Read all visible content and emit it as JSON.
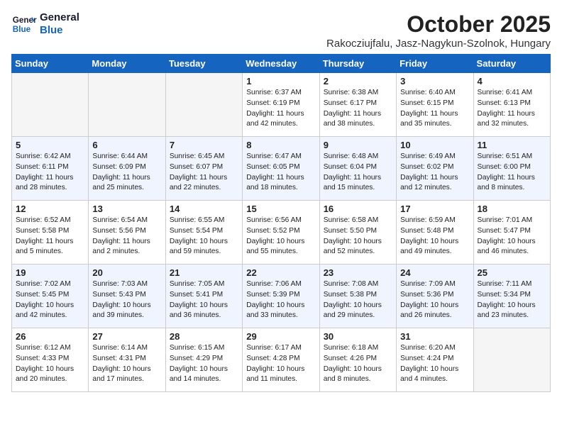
{
  "header": {
    "logo_line1": "General",
    "logo_line2": "Blue",
    "month_title": "October 2025",
    "location": "Rakocziujfalu, Jasz-Nagykun-Szolnok, Hungary"
  },
  "days_of_week": [
    "Sunday",
    "Monday",
    "Tuesday",
    "Wednesday",
    "Thursday",
    "Friday",
    "Saturday"
  ],
  "weeks": [
    [
      {
        "day": "",
        "info": "",
        "empty": true
      },
      {
        "day": "",
        "info": "",
        "empty": true
      },
      {
        "day": "",
        "info": "",
        "empty": true
      },
      {
        "day": "1",
        "info": "Sunrise: 6:37 AM\nSunset: 6:19 PM\nDaylight: 11 hours\nand 42 minutes."
      },
      {
        "day": "2",
        "info": "Sunrise: 6:38 AM\nSunset: 6:17 PM\nDaylight: 11 hours\nand 38 minutes."
      },
      {
        "day": "3",
        "info": "Sunrise: 6:40 AM\nSunset: 6:15 PM\nDaylight: 11 hours\nand 35 minutes."
      },
      {
        "day": "4",
        "info": "Sunrise: 6:41 AM\nSunset: 6:13 PM\nDaylight: 11 hours\nand 32 minutes."
      }
    ],
    [
      {
        "day": "5",
        "info": "Sunrise: 6:42 AM\nSunset: 6:11 PM\nDaylight: 11 hours\nand 28 minutes."
      },
      {
        "day": "6",
        "info": "Sunrise: 6:44 AM\nSunset: 6:09 PM\nDaylight: 11 hours\nand 25 minutes."
      },
      {
        "day": "7",
        "info": "Sunrise: 6:45 AM\nSunset: 6:07 PM\nDaylight: 11 hours\nand 22 minutes."
      },
      {
        "day": "8",
        "info": "Sunrise: 6:47 AM\nSunset: 6:05 PM\nDaylight: 11 hours\nand 18 minutes."
      },
      {
        "day": "9",
        "info": "Sunrise: 6:48 AM\nSunset: 6:04 PM\nDaylight: 11 hours\nand 15 minutes."
      },
      {
        "day": "10",
        "info": "Sunrise: 6:49 AM\nSunset: 6:02 PM\nDaylight: 11 hours\nand 12 minutes."
      },
      {
        "day": "11",
        "info": "Sunrise: 6:51 AM\nSunset: 6:00 PM\nDaylight: 11 hours\nand 8 minutes."
      }
    ],
    [
      {
        "day": "12",
        "info": "Sunrise: 6:52 AM\nSunset: 5:58 PM\nDaylight: 11 hours\nand 5 minutes."
      },
      {
        "day": "13",
        "info": "Sunrise: 6:54 AM\nSunset: 5:56 PM\nDaylight: 11 hours\nand 2 minutes."
      },
      {
        "day": "14",
        "info": "Sunrise: 6:55 AM\nSunset: 5:54 PM\nDaylight: 10 hours\nand 59 minutes."
      },
      {
        "day": "15",
        "info": "Sunrise: 6:56 AM\nSunset: 5:52 PM\nDaylight: 10 hours\nand 55 minutes."
      },
      {
        "day": "16",
        "info": "Sunrise: 6:58 AM\nSunset: 5:50 PM\nDaylight: 10 hours\nand 52 minutes."
      },
      {
        "day": "17",
        "info": "Sunrise: 6:59 AM\nSunset: 5:48 PM\nDaylight: 10 hours\nand 49 minutes."
      },
      {
        "day": "18",
        "info": "Sunrise: 7:01 AM\nSunset: 5:47 PM\nDaylight: 10 hours\nand 46 minutes."
      }
    ],
    [
      {
        "day": "19",
        "info": "Sunrise: 7:02 AM\nSunset: 5:45 PM\nDaylight: 10 hours\nand 42 minutes."
      },
      {
        "day": "20",
        "info": "Sunrise: 7:03 AM\nSunset: 5:43 PM\nDaylight: 10 hours\nand 39 minutes."
      },
      {
        "day": "21",
        "info": "Sunrise: 7:05 AM\nSunset: 5:41 PM\nDaylight: 10 hours\nand 36 minutes."
      },
      {
        "day": "22",
        "info": "Sunrise: 7:06 AM\nSunset: 5:39 PM\nDaylight: 10 hours\nand 33 minutes."
      },
      {
        "day": "23",
        "info": "Sunrise: 7:08 AM\nSunset: 5:38 PM\nDaylight: 10 hours\nand 29 minutes."
      },
      {
        "day": "24",
        "info": "Sunrise: 7:09 AM\nSunset: 5:36 PM\nDaylight: 10 hours\nand 26 minutes."
      },
      {
        "day": "25",
        "info": "Sunrise: 7:11 AM\nSunset: 5:34 PM\nDaylight: 10 hours\nand 23 minutes."
      }
    ],
    [
      {
        "day": "26",
        "info": "Sunrise: 6:12 AM\nSunset: 4:33 PM\nDaylight: 10 hours\nand 20 minutes."
      },
      {
        "day": "27",
        "info": "Sunrise: 6:14 AM\nSunset: 4:31 PM\nDaylight: 10 hours\nand 17 minutes."
      },
      {
        "day": "28",
        "info": "Sunrise: 6:15 AM\nSunset: 4:29 PM\nDaylight: 10 hours\nand 14 minutes."
      },
      {
        "day": "29",
        "info": "Sunrise: 6:17 AM\nSunset: 4:28 PM\nDaylight: 10 hours\nand 11 minutes."
      },
      {
        "day": "30",
        "info": "Sunrise: 6:18 AM\nSunset: 4:26 PM\nDaylight: 10 hours\nand 8 minutes."
      },
      {
        "day": "31",
        "info": "Sunrise: 6:20 AM\nSunset: 4:24 PM\nDaylight: 10 hours\nand 4 minutes."
      },
      {
        "day": "",
        "info": "",
        "empty": true
      }
    ]
  ]
}
